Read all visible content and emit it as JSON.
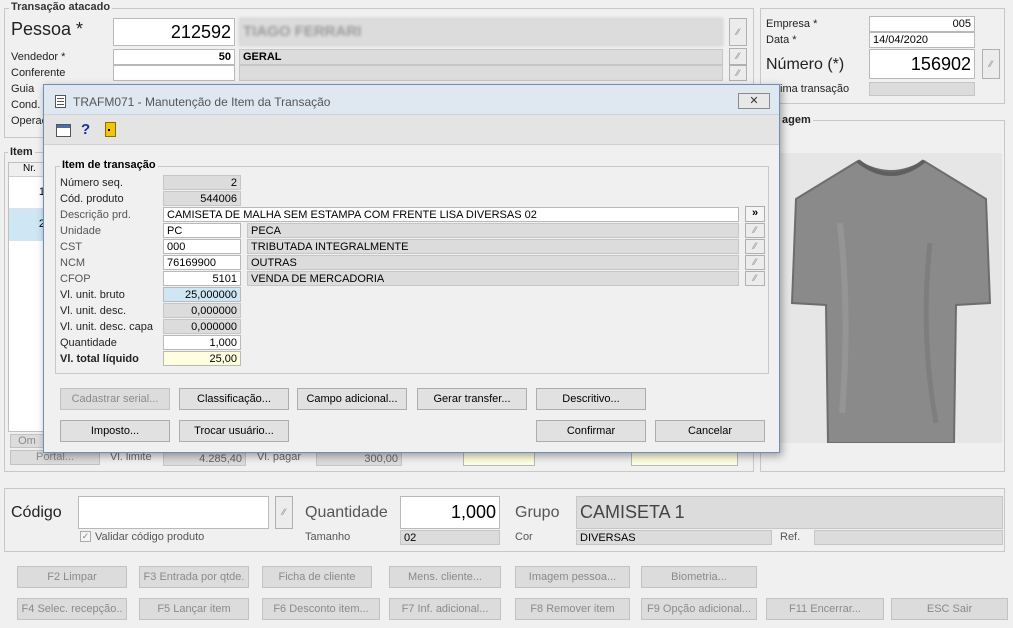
{
  "main": {
    "section_title": "Transação atacado",
    "pessoa_label": "Pessoa *",
    "pessoa_code": "212592",
    "pessoa_name": "TIAGO FERRARI",
    "vendedor_label": "Vendedor *",
    "vendedor_code": "50",
    "vendedor_name": "GERAL",
    "conferente_label": "Conferente",
    "guia_label": "Guia",
    "cond_label": "Cond.",
    "oper_label": "Operac",
    "empresa_label": "Empresa *",
    "empresa_value": "005",
    "data_label": "Data *",
    "data_value": "14/04/2020",
    "numero_label": "Número (*)",
    "numero_value": "156902",
    "ultima_label": "ima transação",
    "imagem_label": "agem",
    "item_label": "Item",
    "nr_label": "Nr.",
    "row1": "1",
    "row2": "2",
    "om_btn": "Om",
    "portal_btn": "Portal...",
    "vl_limite_label": "Vl. limite",
    "vl_limite_value": "4.285,40",
    "vl_pagar_label": "Vl. pagar",
    "vl_pagar_value": "300,00",
    "lookup_glyph": "⁄⁄"
  },
  "dialog": {
    "title": "TRAFM071 - Manutenção de Item da Transação",
    "close_glyph": "✕",
    "help_glyph": "?",
    "group_title": "Item de transação",
    "fields": {
      "numero_seq_label": "Número seq.",
      "numero_seq": "2",
      "cod_produto_label": "Cód. produto",
      "cod_produto": "544006",
      "descricao_label": "Descrição prd.",
      "descricao": "CAMISETA DE MALHA SEM ESTAMPA COM FRENTE LISA DIVERSAS 02",
      "descricao_btn": "»",
      "unidade_label": "Unidade",
      "unidade": "PC",
      "unidade_desc": "PECA",
      "cst_label": "CST",
      "cst": "000",
      "cst_desc": "TRIBUTADA INTEGRALMENTE",
      "ncm_label": "NCM",
      "ncm": "76169900",
      "ncm_desc": "OUTRAS",
      "cfop_label": "CFOP",
      "cfop": "5101",
      "cfop_desc": "VENDA DE MERCADORIA",
      "vl_unit_bruto_label": "Vl. unit. bruto",
      "vl_unit_bruto": "25,000000",
      "vl_unit_desc_label": "Vl. unit. desc.",
      "vl_unit_desc": "0,000000",
      "vl_unit_desc_capa_label": "Vl. unit. desc. capa",
      "vl_unit_desc_capa": "0,000000",
      "quantidade_label": "Quantidade",
      "quantidade": "1,000",
      "vl_total_label": "Vl. total líquido",
      "vl_total": "25,00"
    },
    "buttons": {
      "cadastrar_serial": "Cadastrar serial...",
      "classificacao": "Classificação...",
      "campo_adicional": "Campo adicional...",
      "gerar_transfer": "Gerar transfer...",
      "descritivo": "Descritivo...",
      "imposto": "Imposto...",
      "trocar_usuario": "Trocar usuário...",
      "confirmar": "Confirmar",
      "cancelar": "Cancelar"
    }
  },
  "bottom": {
    "codigo_label": "Código",
    "codigo_value": "",
    "quantidade_label": "Quantidade",
    "quantidade_value": "1,000",
    "grupo_label": "Grupo",
    "grupo_value": "CAMISETA 1",
    "validar_label": "Validar código produto",
    "tamanho_label": "Tamanho",
    "tamanho_value": "02",
    "cor_label": "Cor",
    "cor_value": "DIVERSAS",
    "ref_label": "Ref.",
    "ref_value": ""
  },
  "function_buttons": {
    "row1": [
      "F2 Limpar",
      "F3 Entrada por qtde.",
      "Ficha de cliente",
      "Mens. cliente...",
      "Imagem pessoa...",
      "Biometria..."
    ],
    "row2": [
      "F4 Selec. recepção..",
      "F5 Lançar item",
      "F6 Desconto item...",
      "F7 Inf. adicional...",
      "F8 Remover item",
      "F9 Opção adicional...",
      "F11 Encerrar...",
      "ESC Sair"
    ]
  },
  "colors": {
    "accent": "#cfe7f5",
    "highlight": "#ffffe0",
    "titlebar": "#dfe7f1"
  }
}
